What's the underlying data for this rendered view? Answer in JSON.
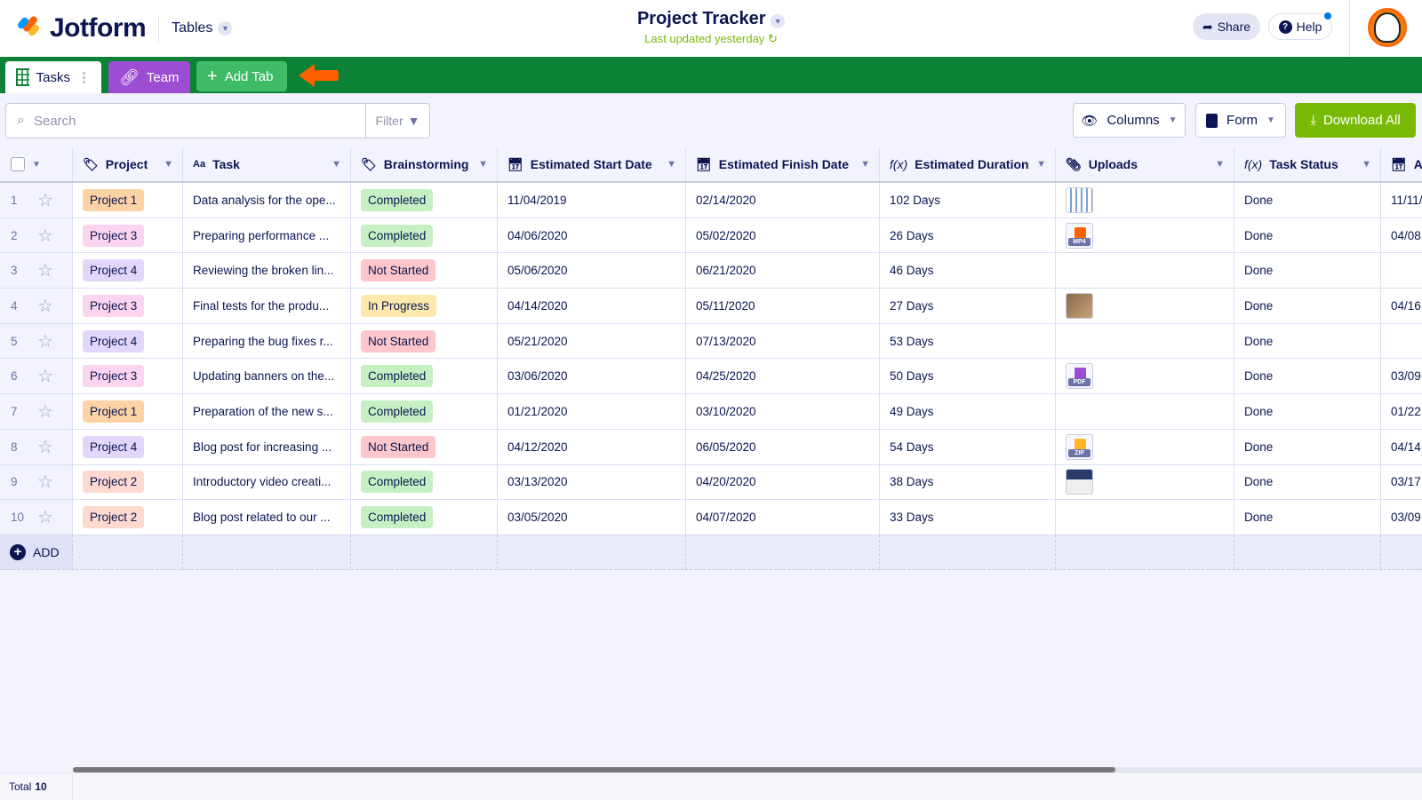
{
  "app": {
    "brand": "Jotform",
    "section": "Tables"
  },
  "doc": {
    "title": "Project Tracker",
    "subtitle": "Last updated yesterday"
  },
  "header": {
    "share": "Share",
    "help": "Help"
  },
  "tabs": [
    {
      "label": "Tasks"
    },
    {
      "label": "Team"
    },
    {
      "label": "Add Tab"
    }
  ],
  "toolbar": {
    "search_placeholder": "Search",
    "filter": "Filter",
    "columns": "Columns",
    "form": "Form",
    "download": "Download All"
  },
  "columns": [
    "Project",
    "Task",
    "Brainstorming",
    "Estimated Start Date",
    "Estimated Finish Date",
    "Estimated Duration",
    "Uploads",
    "Task Status",
    "A"
  ],
  "rows": [
    {
      "n": "1",
      "project": "Project 1",
      "task": "Data analysis for the ope...",
      "status": "Completed",
      "start": "11/04/2019",
      "finish": "02/14/2020",
      "duration": "102 Days",
      "upload": "image",
      "done": "Done",
      "extra": "11/11/"
    },
    {
      "n": "2",
      "project": "Project 3",
      "task": "Preparing performance ...",
      "status": "Completed",
      "start": "04/06/2020",
      "finish": "05/02/2020",
      "duration": "26 Days",
      "upload": "MP4",
      "done": "Done",
      "extra": "04/08"
    },
    {
      "n": "3",
      "project": "Project 4",
      "task": "Reviewing the broken lin...",
      "status": "Not Started",
      "start": "05/06/2020",
      "finish": "06/21/2020",
      "duration": "46 Days",
      "upload": "",
      "done": "Done",
      "extra": ""
    },
    {
      "n": "4",
      "project": "Project 3",
      "task": "Final tests for the produ...",
      "status": "In Progress",
      "start": "04/14/2020",
      "finish": "05/11/2020",
      "duration": "27 Days",
      "upload": "photo",
      "done": "Done",
      "extra": "04/16"
    },
    {
      "n": "5",
      "project": "Project 4",
      "task": "Preparing the bug fixes r...",
      "status": "Not Started",
      "start": "05/21/2020",
      "finish": "07/13/2020",
      "duration": "53 Days",
      "upload": "",
      "done": "Done",
      "extra": ""
    },
    {
      "n": "6",
      "project": "Project 3",
      "task": "Updating banners on the...",
      "status": "Completed",
      "start": "03/06/2020",
      "finish": "04/25/2020",
      "duration": "50 Days",
      "upload": "PDF",
      "done": "Done",
      "extra": "03/09"
    },
    {
      "n": "7",
      "project": "Project 1",
      "task": "Preparation of the new s...",
      "status": "Completed",
      "start": "01/21/2020",
      "finish": "03/10/2020",
      "duration": "49 Days",
      "upload": "",
      "done": "Done",
      "extra": "01/22"
    },
    {
      "n": "8",
      "project": "Project 4",
      "task": "Blog post for increasing ...",
      "status": "Not Started",
      "start": "04/12/2020",
      "finish": "06/05/2020",
      "duration": "54 Days",
      "upload": "ZIP",
      "done": "Done",
      "extra": "04/14"
    },
    {
      "n": "9",
      "project": "Project 2",
      "task": "Introductory video creati...",
      "status": "Completed",
      "start": "03/13/2020",
      "finish": "04/20/2020",
      "duration": "38 Days",
      "upload": "screenshot",
      "done": "Done",
      "extra": "03/17"
    },
    {
      "n": "10",
      "project": "Project 2",
      "task": "Blog post related to our ...",
      "status": "Completed",
      "start": "03/05/2020",
      "finish": "04/07/2020",
      "duration": "33 Days",
      "upload": "",
      "done": "Done",
      "extra": "03/09"
    }
  ],
  "add_label": "ADD",
  "footer": {
    "total_label": "Total",
    "total": "10"
  },
  "colors": {
    "green_bar": "#0b8236",
    "accent": "#78bb07",
    "Project 1": "#fdd3a6",
    "Project 2": "#fdd9d0",
    "Project 3": "#fbd5ef",
    "Project 4": "#e3d6fb",
    "Completed": "#c6f0c4",
    "Not Started": "#fcc6cb",
    "In Progress": "#fde9ab"
  }
}
